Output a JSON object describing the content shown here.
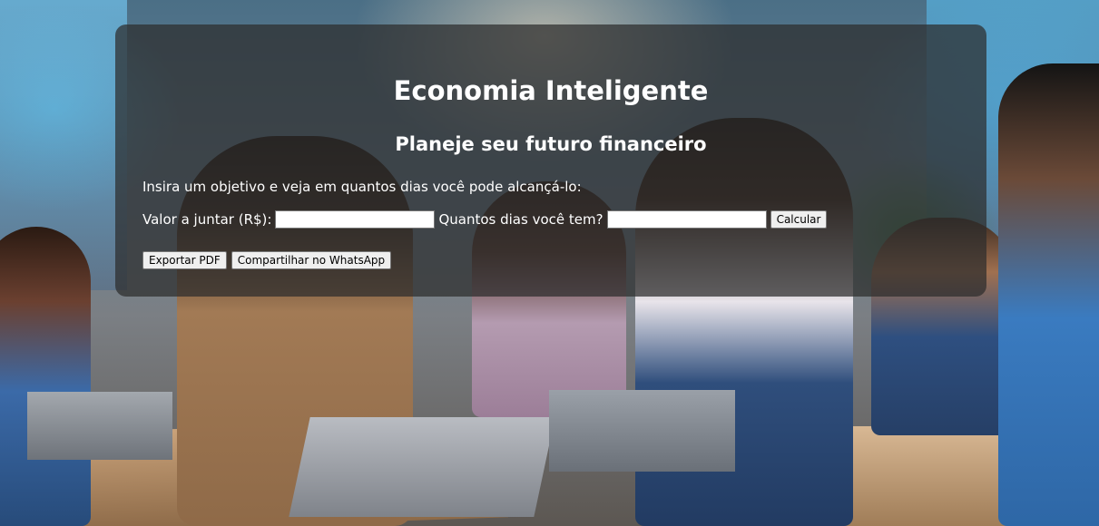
{
  "header": {
    "title": "Economia Inteligente",
    "subtitle": "Planeje seu futuro financeiro"
  },
  "form": {
    "intro": "Insira um objetivo e veja em quantos dias você pode alcançá-lo:",
    "amount_label": "Valor a juntar (R$):",
    "amount_value": "",
    "days_label": "Quantos dias você tem?",
    "days_value": "",
    "calculate_label": "Calcular"
  },
  "actions": {
    "export_pdf_label": "Exportar PDF",
    "share_whatsapp_label": "Compartilhar no WhatsApp"
  },
  "background": {
    "description_icon": "office-photo-background"
  }
}
